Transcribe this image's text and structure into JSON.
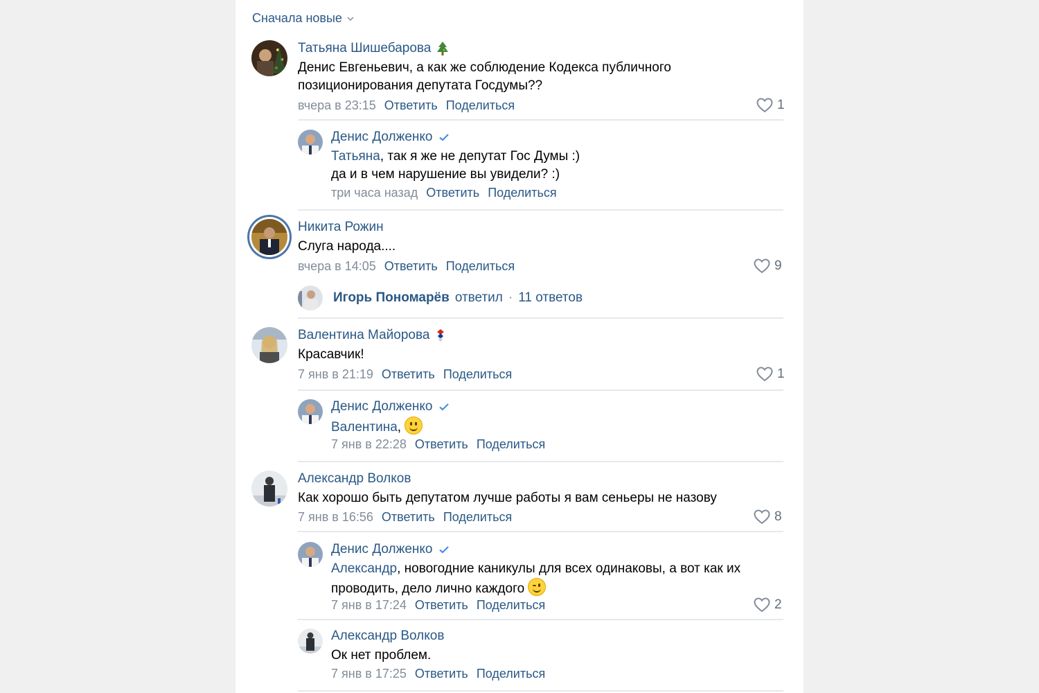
{
  "sort": {
    "label": "Сначала новые"
  },
  "labels": {
    "reply": "Ответить",
    "share": "Поделиться"
  },
  "comments": [
    {
      "author": "Татьяна Шишебарова",
      "text_line1": "Денис Евгеньевич, а как же соблюдение Кодекса публичного",
      "text_line2": "позиционирования депутата Госдумы??",
      "time": "вчера в 23:15",
      "likes": "1"
    },
    {
      "author": "Денис Долженко",
      "mention": "Татьяна",
      "text_line1": ", так я же не депутат Гос Думы :)",
      "text_line2": "да и в чем нарушение вы увидели? :)",
      "time": "три часа назад"
    },
    {
      "author": "Никита Рожин",
      "text_line1": "Слуга народа....",
      "time": "вчера в 14:05",
      "likes": "9",
      "replies": {
        "who": "Игорь Пономарёв",
        "action": "ответил",
        "dot": "·",
        "count": "11 ответов"
      }
    },
    {
      "author": "Валентина Майорова",
      "text_line1": "Красавчик!",
      "time": "7 янв в 21:19",
      "likes": "1"
    },
    {
      "author": "Денис Долженко",
      "mention": "Валентина",
      "text_line1": ",",
      "time": "7 янв в 22:28"
    },
    {
      "author": "Александр Волков",
      "text_line1": "Как хорошо быть депутатом лучше работы я вам сеньеры не назову",
      "time": "7 янв в 16:56",
      "likes": "8"
    },
    {
      "author": "Денис Долженко",
      "mention": "Александр",
      "text_line1": ", новогодние каникулы для всех одинаковы, а вот как их",
      "text_line2": "проводить, дело лично каждого",
      "time": "7 янв в 17:24",
      "likes": "2"
    },
    {
      "author": "Александр Волков",
      "text_line1": "Ок нет проблем.",
      "time": "7 янв в 17:25"
    }
  ],
  "colors": {
    "link": "#2a5885",
    "meta": "#818c99",
    "divider": "#e7e8ec",
    "verified": "#4a90e2"
  }
}
